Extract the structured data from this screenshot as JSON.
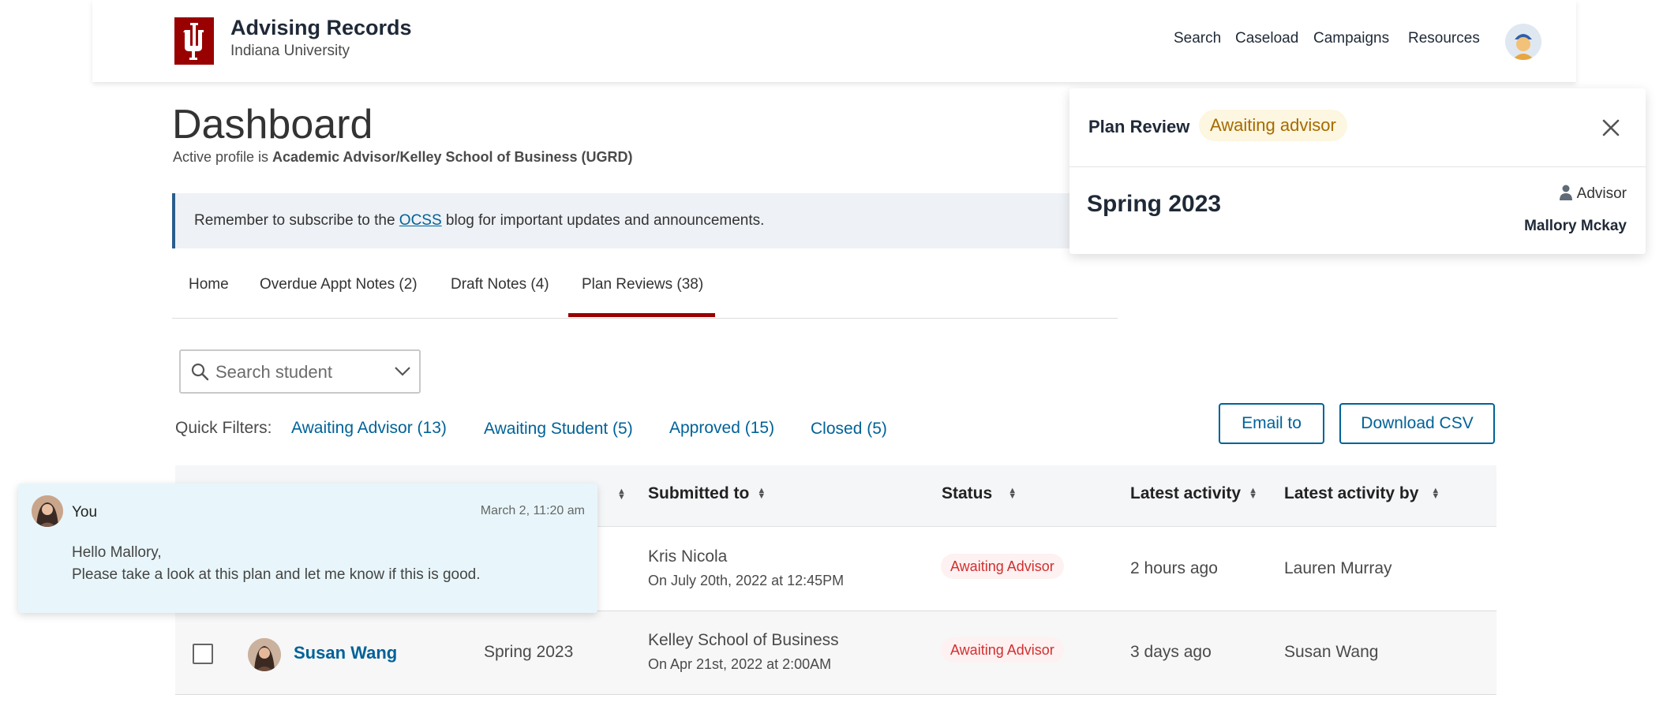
{
  "header": {
    "title": "Advising Records",
    "subtitle": "Indiana University",
    "nav": [
      "Search",
      "Caseload",
      "Campaigns",
      "Resources"
    ]
  },
  "dashboard": {
    "title": "Dashboard",
    "profile_prefix": "Active profile is ",
    "profile_value": "Academic Advisor/Kelley School of Business (UGRD)"
  },
  "notice": {
    "before": "Remember to subscribe to the ",
    "link": "OCSS",
    "after": " blog for important updates and announcements."
  },
  "tabs": [
    {
      "label": "Home"
    },
    {
      "label": "Overdue Appt Notes (2)"
    },
    {
      "label": "Draft Notes (4)"
    },
    {
      "label": "Plan Reviews (38)",
      "active": true
    }
  ],
  "search": {
    "placeholder": "Search student"
  },
  "quick_filters": {
    "label": "Quick Filters:",
    "items": [
      "Awaiting Advisor (13)",
      "Awaiting Student (5)",
      "Approved (15)",
      "Closed (5)"
    ]
  },
  "actions": {
    "email": "Email to",
    "download": "Download CSV"
  },
  "table": {
    "headers": [
      "Submitted to",
      "Status",
      "Latest activity",
      "Latest activity by"
    ],
    "rows": [
      {
        "student": "",
        "term": "",
        "submitted_to": "Kris Nicola",
        "submitted_on": "On July 20th, 2022 at 12:45PM",
        "status": "Awaiting Advisor",
        "latest_activity": "2 hours ago",
        "latest_by": "Lauren Murray"
      },
      {
        "student": "Susan Wang",
        "term": "Spring 2023",
        "submitted_to": "Kelley School of Business",
        "submitted_on": "On Apr 21st, 2022 at 2:00AM",
        "status": "Awaiting Advisor",
        "latest_activity": "3 days ago",
        "latest_by": "Susan Wang"
      }
    ]
  },
  "chat": {
    "author": "You",
    "time": "March 2, 11:20 am",
    "lines": [
      "Hello Mallory,",
      "Please take a look at this plan and let me know if this is good."
    ]
  },
  "plan_review": {
    "title": "Plan Review",
    "badge": "Awaiting advisor",
    "term": "Spring 2023",
    "role": "Advisor",
    "advisor": "Mallory Mckay"
  },
  "colors": {
    "brand": "#990000",
    "link": "#006298",
    "status_red": "#d32f2f",
    "awaiting_badge": "#a66b00"
  }
}
